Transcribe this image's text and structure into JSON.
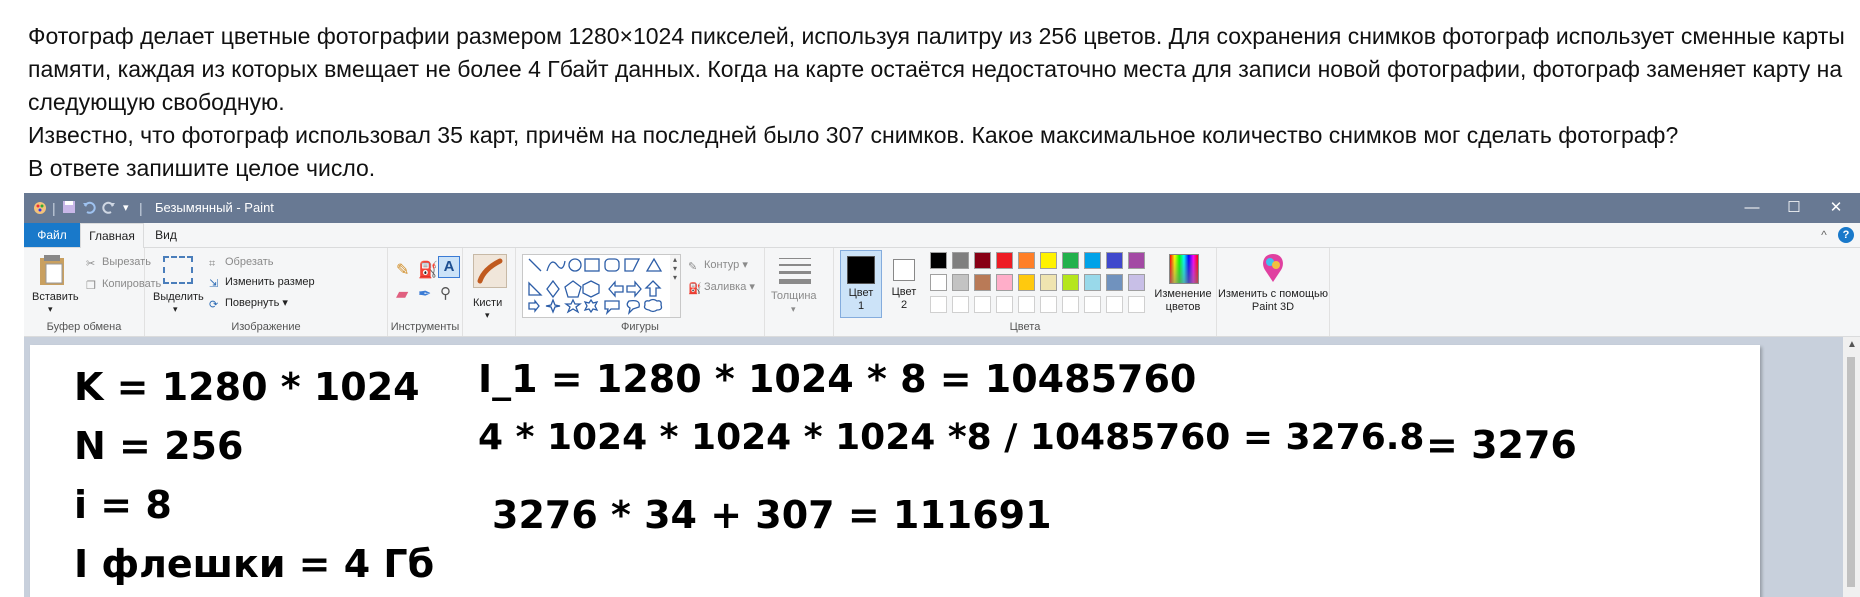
{
  "task": {
    "paragraph1": "Фотограф делает цветные фотографии размером 1280×1024 пикселей, используя палитру из 256 цветов. Для сохранения снимков фотограф использует сменные карты памяти, каждая из которых вмещает не более 4 Гбайт данных. Когда на карте остаётся недостаточно места для записи новой фотографии, фотограф заменяет карту на следующую свободную.",
    "paragraph2": "Известно, что фотограф использовал 35 карт, причём на последней было 307 снимков. Какое максимальное количество снимков мог сделать фотограф?",
    "paragraph3": "В ответе запишите целое число."
  },
  "window": {
    "title": "Безымянный - Paint",
    "minimize": "—",
    "maximize": "☐",
    "close": "✕"
  },
  "menu": {
    "file": "Файл",
    "home": "Главная",
    "view": "Вид",
    "collapse": "^",
    "help": "?"
  },
  "ribbon": {
    "clipboard": {
      "paste": "Вставить",
      "cut": "Вырезать",
      "copy": "Копировать",
      "label": "Буфер обмена"
    },
    "image": {
      "select": "Выделить",
      "crop": "Обрезать",
      "resize": "Изменить размер",
      "rotate": "Повернуть",
      "label": "Изображение"
    },
    "tools": {
      "label": "Инструменты"
    },
    "brushes": {
      "label": "Кисти"
    },
    "shapes": {
      "outline": "Контур",
      "fill": "Заливка",
      "label": "Фигуры"
    },
    "size": {
      "label": "Толщина"
    },
    "colors": {
      "color1": "Цвет 1",
      "color2": "Цвет 2",
      "edit": "Изменение цветов",
      "label": "Цвета",
      "row1": [
        "#000000",
        "#7f7f7f",
        "#880015",
        "#ed1c24",
        "#ff7f27",
        "#fff200",
        "#22b14c",
        "#00a2e8",
        "#3f48cc",
        "#a349a4"
      ],
      "row2": [
        "#ffffff",
        "#c3c3c3",
        "#b97a57",
        "#ffaec9",
        "#ffc90e",
        "#efe4b0",
        "#b5e61d",
        "#99d9ea",
        "#7092be",
        "#c8bfe7"
      ],
      "color1_value": "#000000",
      "color2_value": "#ffffff"
    },
    "paint3d": {
      "label": "Изменить с помощью Paint 3D"
    }
  },
  "canvas": {
    "line1": "K = 1280 * 1024",
    "line2": "N = 256",
    "line3": "i = 8",
    "line4": "I флешки = 4 Гб",
    "calc1": "I_1 = 1280 * 1024 * 8 = 10485760",
    "calc2": "4 * 1024 * 1024 * 1024 *8  / 10485760 = 3276.8",
    "calc2b": "= 3276",
    "calc3": "3276 * 34 + 307 = 111691"
  }
}
